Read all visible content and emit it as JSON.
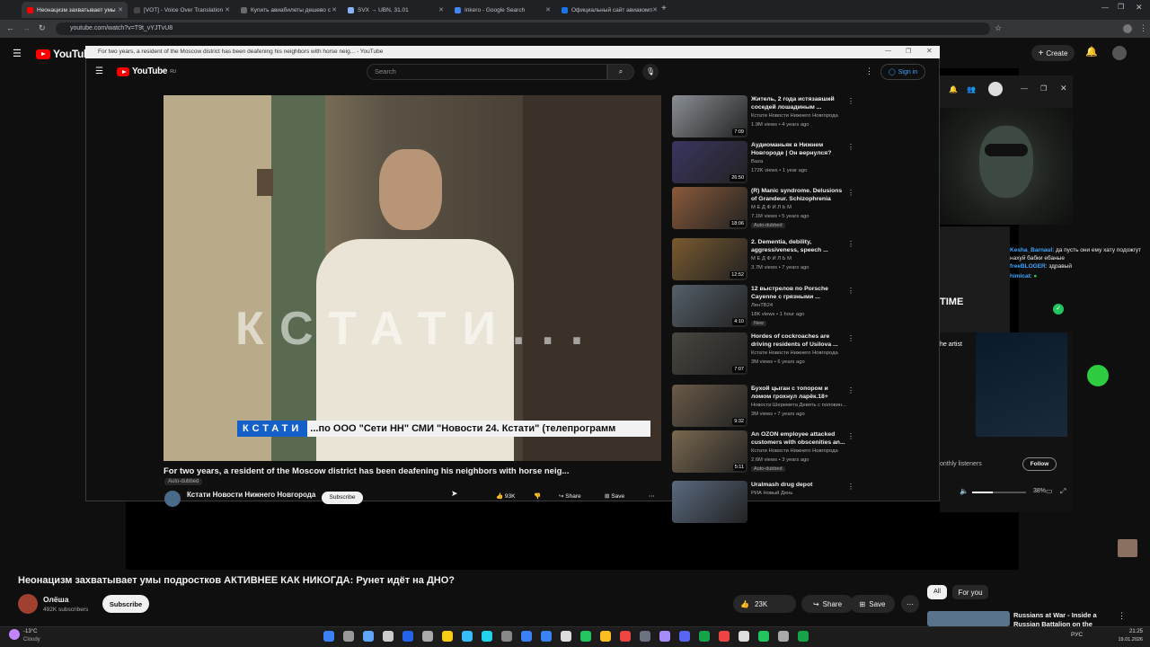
{
  "browser": {
    "tabs": [
      {
        "label": "Неонацизм захватывает умы",
        "color": "#ff0000"
      },
      {
        "label": "[VOT] - Voice Over Translation",
        "color": "#444444"
      },
      {
        "label": "Купить авиабилеты дешево с",
        "color": "#6a6a6a"
      },
      {
        "label": "SVX → UBN, 31.01",
        "color": "#8ab4f8"
      },
      {
        "label": "Inkero - Google Search",
        "color": "#4285f4"
      },
      {
        "label": "Официальный сайт авиакомп",
        "color": "#1a73e8"
      }
    ],
    "url": "youtube.com/watch?v=T9t_vYJTvU8"
  },
  "background": {
    "logo": "YouTube",
    "create_label": "Create",
    "video_title": "Неонацизм захватывает умы подростков АКТИВНЕЕ КАК НИКОГДА: Рунет идёт на ДНО?",
    "channel": "Олёша",
    "subscribers": "492K subscribers",
    "subscribe": "Subscribe",
    "likes": "23K",
    "share": "Share",
    "save": "Save",
    "filter_all": "All",
    "filter_foryou": "For you",
    "side_title": "Russians at War - Inside a Russian Battalion on the Front"
  },
  "window": {
    "title": "For two years, a resident of the Moscow district has been deafening his neighbors with horse neig... - YouTube",
    "logo": "YouTube",
    "logo_sup": "RU",
    "search_placeholder": "Search",
    "sign_in": "Sign in",
    "video_title": "For two years, a resident of the Moscow district has been deafening his neighbors with horse neig...",
    "auto_dubbed": "Auto-dubbed",
    "channel": "Кстати Новости Нижнего Новгорода",
    "subscribe": "Subscribe",
    "likes": "93K",
    "share": "Share",
    "save": "Save",
    "watermark": "КСТАТИ...",
    "ticker_brand": "КСТАТИ",
    "ticker_text": "...по ООО \"Сети НН\" СМИ \"Новости 24. Кстати\" (телепрограмм"
  },
  "recommendations": [
    {
      "title": "Житель, 2 года истязавший соседей лошадиным ...",
      "channel": "Кстати Новости Нижнего Новгорода",
      "meta": "1.9M views • 4 years ago",
      "duration": "7:09",
      "color": "#8a8f94",
      "badge": ""
    },
    {
      "title": "Аудиоманьяк в Нижнем Новгороде | Он вернулся?",
      "channel": "Baza",
      "meta": "172K views • 1 year ago",
      "duration": "26:50",
      "color": "#3a3560",
      "badge": ""
    },
    {
      "title": "(R) Manic syndrome. Delusions of Grandeur. Schizophrenia",
      "channel": "М Е Д Ф И Л Ь М",
      "meta": "7.1M views • 5 years ago",
      "duration": "18:06",
      "color": "#8a5a3a",
      "badge": "Auto-dubbed"
    },
    {
      "title": "2. Dementia, debility, aggressiveness, speech ...",
      "channel": "М Е Д Ф И Л Ь М",
      "meta": "3.7M views • 7 years ago",
      "duration": "12:52",
      "color": "#7a5a30",
      "badge": ""
    },
    {
      "title": "12 выстрелов по Porsche Cayenne с грязными ...",
      "channel": "ЛенТВ24",
      "meta": "18K views • 1 hour ago",
      "duration": "4:10",
      "color": "#55606a",
      "badge": "New"
    },
    {
      "title": "Hordes of cockroaches are driving residents of Usilova ...",
      "channel": "Кстати Новости Нижнего Новгорода",
      "meta": "3M views • 6 years ago",
      "duration": "7:07",
      "color": "#4a4640",
      "badge": ""
    },
    {
      "title": "Бухой цыган с топором и ломом грохнул ларёк.18+",
      "channel": "Новости Шереметa Девять с половин...",
      "meta": "3M views • 7 years ago",
      "duration": "9:32",
      "color": "#6a5a48",
      "badge": ""
    },
    {
      "title": "An OZON employee attacked customers with obscenities an...",
      "channel": "Кстати Новости Нижнего Новгорода",
      "meta": "2.6M views • 3 years ago",
      "duration": "5:11",
      "color": "#7a6850",
      "badge": "Auto-dubbed"
    },
    {
      "title": "Uralmash drug depot",
      "channel": "РИА Новый День",
      "meta": "",
      "duration": "",
      "color": "#5a6a80",
      "badge": ""
    }
  ],
  "chat": {
    "messages": [
      {
        "user": "Kesha_Barnaul",
        "text": ": да пусть они ему хату подожгут нахуй бабки ебаные",
        "color": "#3ea6ff"
      },
      {
        "user": "freeBLOGER",
        "text": ": здравый",
        "color": "#3ea6ff"
      },
      {
        "user": "himicat",
        "text": ":",
        "color": "#3ea6ff"
      }
    ]
  },
  "spotify": {
    "time_label": "TIME",
    "artist_label": "he artist",
    "listeners": "onthly listeners",
    "follow": "Follow",
    "volume": "38%"
  },
  "taskbar": {
    "weather_temp": "-13°C",
    "weather_cond": "Cloudy",
    "lang": "РУС",
    "time": "21:25",
    "date": "19.01.2026"
  }
}
